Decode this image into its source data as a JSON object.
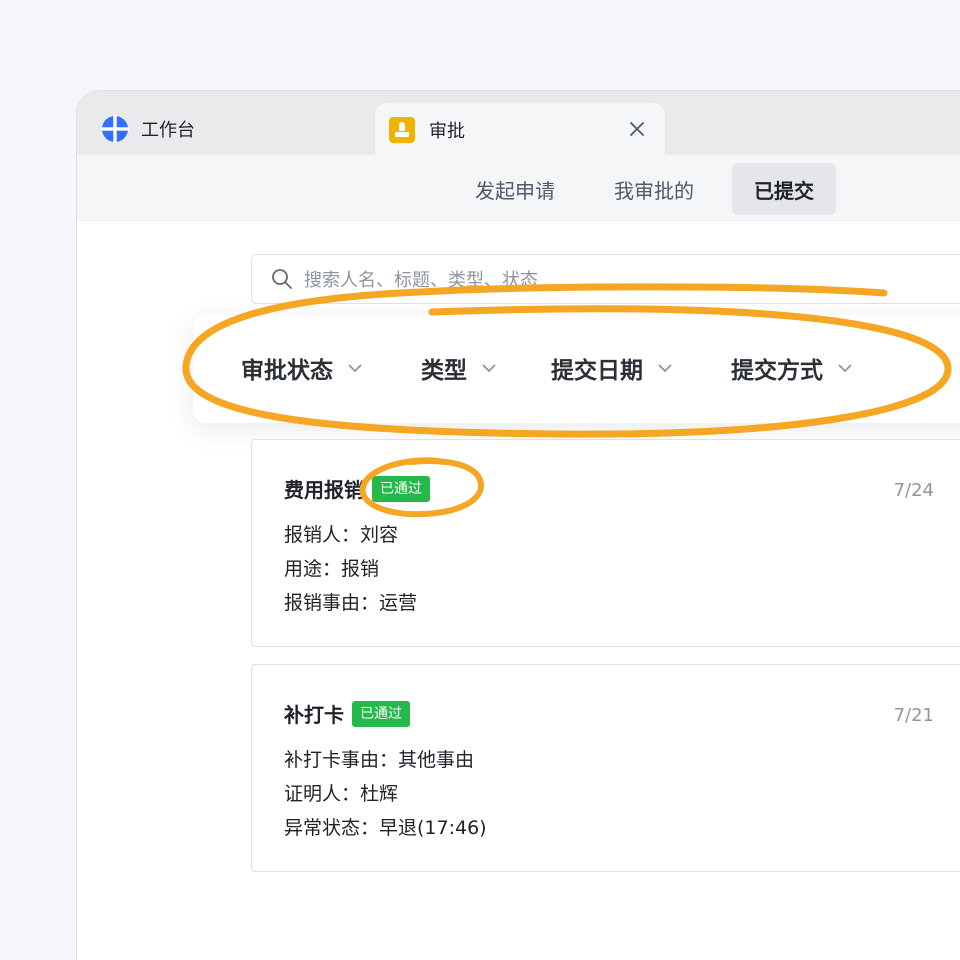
{
  "tabs": {
    "home_label": "工作台",
    "active_label": "审批"
  },
  "subnav": [
    "发起申请",
    "我审批的",
    "已提交"
  ],
  "search": {
    "placeholder": "搜索人名、标题、类型、状态"
  },
  "filters": [
    "审批状态",
    "类型",
    "提交日期",
    "提交方式"
  ],
  "cards": [
    {
      "title": "费用报销",
      "status": "已通过",
      "date": "7/24",
      "lines": [
        "报销人：刘容",
        "用途：报销",
        "报销事由：运营"
      ]
    },
    {
      "title": "补打卡",
      "status": "已通过",
      "date": "7/21",
      "lines": [
        "补打卡事由：其他事由",
        "证明人：杜辉",
        "异常状态：早退(17:46)"
      ]
    }
  ],
  "colors": {
    "accent_highlight": "#f5a623",
    "status_green": "#25b84a",
    "workbench_icon": "#3370ff",
    "approval_icon": "#f0b400"
  },
  "icons": [
    "workbench-icon",
    "approval-icon",
    "close-icon",
    "search-icon",
    "chevron-down-icon"
  ]
}
